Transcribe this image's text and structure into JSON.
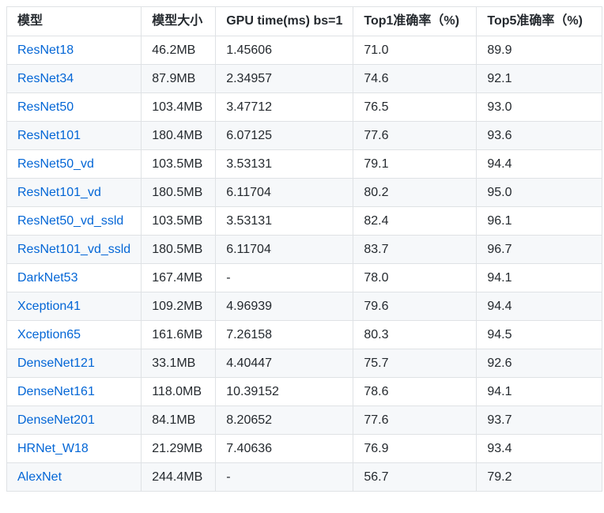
{
  "table": {
    "headers": [
      "模型",
      "模型大小",
      "GPU time(ms) bs=1",
      "Top1准确率（%)",
      "Top5准确率（%)"
    ],
    "rows": [
      {
        "model": "ResNet18",
        "size": "46.2MB",
        "gpu_time": "1.45606",
        "top1": "71.0",
        "top5": "89.9"
      },
      {
        "model": "ResNet34",
        "size": "87.9MB",
        "gpu_time": "2.34957",
        "top1": "74.6",
        "top5": "92.1"
      },
      {
        "model": "ResNet50",
        "size": "103.4MB",
        "gpu_time": "3.47712",
        "top1": "76.5",
        "top5": "93.0"
      },
      {
        "model": "ResNet101",
        "size": "180.4MB",
        "gpu_time": "6.07125",
        "top1": "77.6",
        "top5": "93.6"
      },
      {
        "model": "ResNet50_vd",
        "size": "103.5MB",
        "gpu_time": "3.53131",
        "top1": "79.1",
        "top5": "94.4"
      },
      {
        "model": "ResNet101_vd",
        "size": "180.5MB",
        "gpu_time": "6.11704",
        "top1": "80.2",
        "top5": "95.0"
      },
      {
        "model": "ResNet50_vd_ssld",
        "size": "103.5MB",
        "gpu_time": "3.53131",
        "top1": "82.4",
        "top5": "96.1"
      },
      {
        "model": "ResNet101_vd_ssld",
        "size": "180.5MB",
        "gpu_time": "6.11704",
        "top1": "83.7",
        "top5": "96.7"
      },
      {
        "model": "DarkNet53",
        "size": "167.4MB",
        "gpu_time": "-",
        "top1": "78.0",
        "top5": "94.1"
      },
      {
        "model": "Xception41",
        "size": "109.2MB",
        "gpu_time": "4.96939",
        "top1": "79.6",
        "top5": "94.4"
      },
      {
        "model": "Xception65",
        "size": "161.6MB",
        "gpu_time": "7.26158",
        "top1": "80.3",
        "top5": "94.5"
      },
      {
        "model": "DenseNet121",
        "size": "33.1MB",
        "gpu_time": "4.40447",
        "top1": "75.7",
        "top5": "92.6"
      },
      {
        "model": "DenseNet161",
        "size": "118.0MB",
        "gpu_time": "10.39152",
        "top1": "78.6",
        "top5": "94.1"
      },
      {
        "model": "DenseNet201",
        "size": "84.1MB",
        "gpu_time": "8.20652",
        "top1": "77.6",
        "top5": "93.7"
      },
      {
        "model": "HRNet_W18",
        "size": "21.29MB",
        "gpu_time": "7.40636",
        "top1": "76.9",
        "top5": "93.4"
      },
      {
        "model": "AlexNet",
        "size": "244.4MB",
        "gpu_time": "-",
        "top1": "56.7",
        "top5": "79.2"
      }
    ]
  },
  "colors": {
    "link": "#0366d6",
    "border": "#dfe2e5",
    "stripe": "#f6f8fa",
    "text": "#24292e"
  }
}
